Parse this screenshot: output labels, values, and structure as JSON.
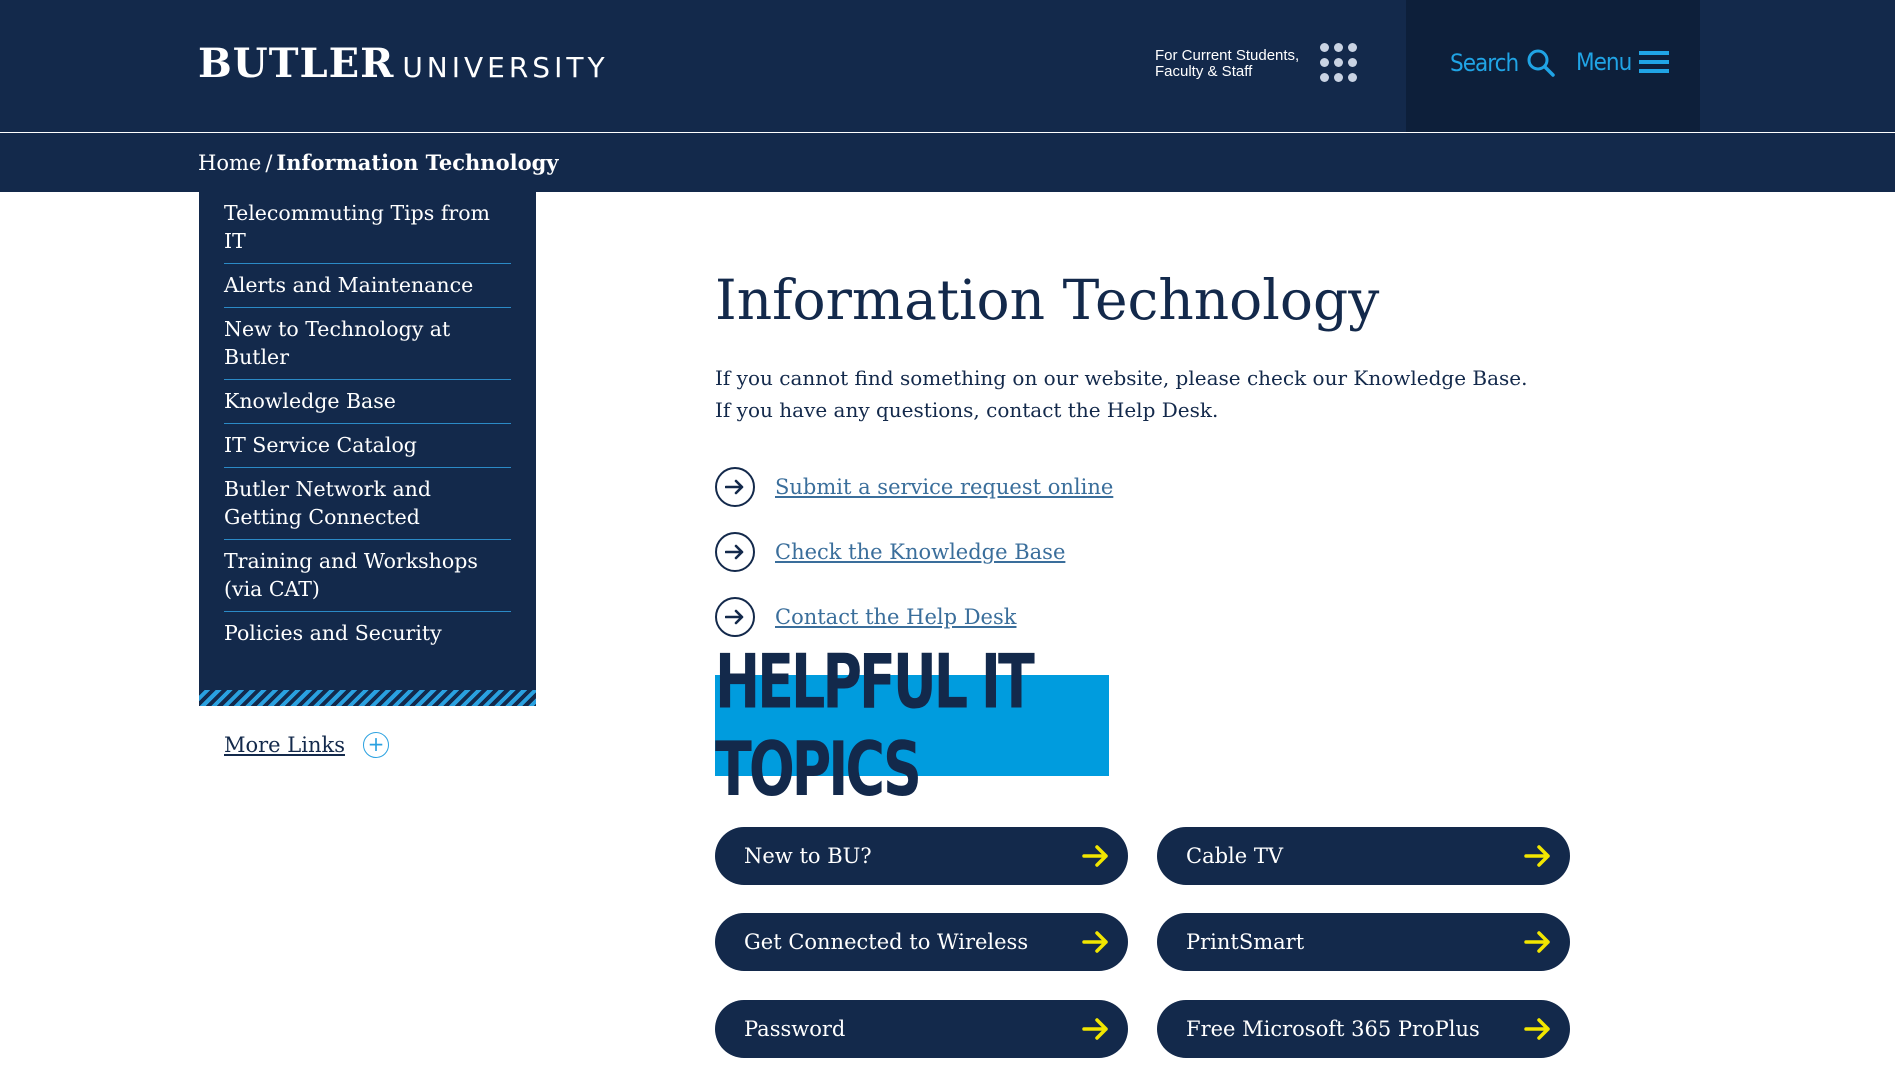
{
  "header": {
    "logo_bold": "BUTLER",
    "logo_light": "UNIVERSITY",
    "current_line1": "For Current Students,",
    "current_line2": "Faculty & Staff",
    "search_label": "Search",
    "menu_label": "Menu"
  },
  "breadcrumb": {
    "home": "Home",
    "separator": "/",
    "current": "Information Technology"
  },
  "sidebar": {
    "items": [
      {
        "label": "Telecommuting Tips from IT"
      },
      {
        "label": "Alerts and Maintenance"
      },
      {
        "label": "New to Technology at Butler"
      },
      {
        "label": "Knowledge Base"
      },
      {
        "label": "IT Service Catalog"
      },
      {
        "label": "Butler Network and Getting Connected"
      },
      {
        "label": "Training and Workshops (via CAT)"
      },
      {
        "label": "Policies and Security"
      }
    ],
    "more_links": "More Links"
  },
  "main": {
    "title": "Information Technology",
    "intro": "If you cannot find something on our website, please check our Knowledge Base. If you have any questions, contact the Help Desk.",
    "links": [
      {
        "label": "Submit a service request online"
      },
      {
        "label": "Check the Knowledge Base"
      },
      {
        "label": "Contact the Help Desk"
      }
    ],
    "banner": "HELPFUL IT TOPICS",
    "topics": [
      {
        "label": "New to BU?"
      },
      {
        "label": "Cable TV"
      },
      {
        "label": "Get Connected to Wireless"
      },
      {
        "label": "PrintSmart"
      },
      {
        "label": "Password"
      },
      {
        "label": "Free Microsoft 365 ProPlus"
      }
    ]
  },
  "colors": {
    "navy": "#13294b",
    "accent_blue": "#009cde",
    "link_blue": "#3a6e9b",
    "arrow_yellow": "#f2e600"
  },
  "icons": [
    "grid-dots-icon",
    "search-icon",
    "hamburger-menu-icon",
    "plus-circle-icon",
    "arrow-circle-icon",
    "arrow-right-icon"
  ]
}
